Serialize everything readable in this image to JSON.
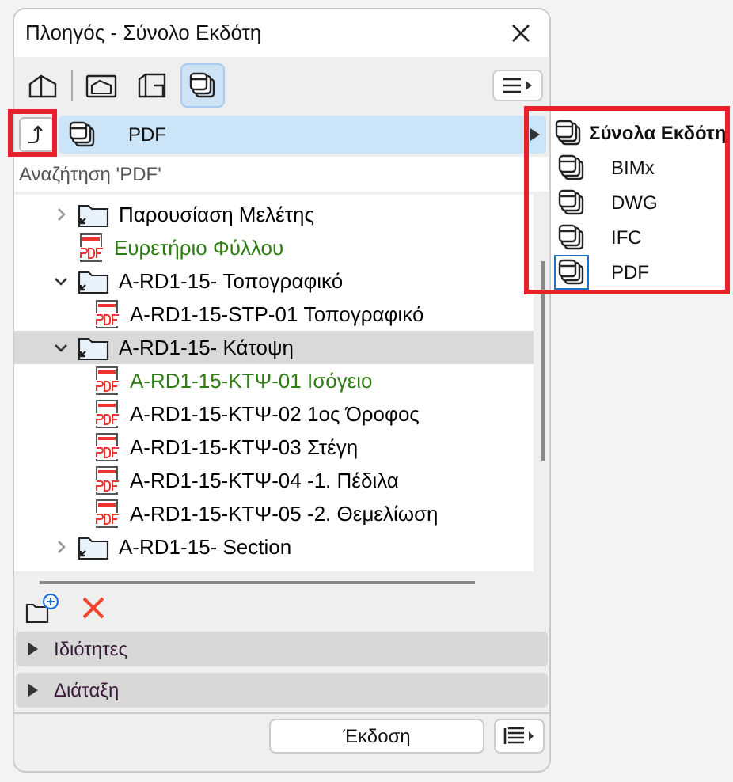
{
  "window": {
    "title": "Πλοηγός - Σύνολο Εκδότη"
  },
  "toolbar": {
    "buttons": [
      {
        "kind": "project",
        "selected": false
      },
      {
        "kind": "view",
        "selected": false
      },
      {
        "kind": "layout",
        "selected": false
      },
      {
        "kind": "publisher",
        "selected": true
      }
    ]
  },
  "current_set": {
    "label": "PDF"
  },
  "search": {
    "placeholder": "Αναζήτηση 'PDF'"
  },
  "tree": [
    {
      "kind": "folder",
      "label": "Παρουσίαση Μελέτης",
      "expanded": false,
      "selected": false,
      "color": "#000000"
    },
    {
      "kind": "pdf",
      "label": "Ευρετήριο Φύλλου",
      "selected": false,
      "color": "#2e7d14"
    },
    {
      "kind": "folder",
      "label": "A-RD1-15- Τοπογραφικό",
      "expanded": true,
      "selected": false,
      "color": "#000000",
      "children": [
        {
          "kind": "pdf",
          "label": "A-RD1-15-STP-01 Τοπογραφικό",
          "selected": false,
          "color": "#000000"
        }
      ]
    },
    {
      "kind": "folder",
      "label": "A-RD1-15- Κάτοψη",
      "expanded": true,
      "selected": true,
      "color": "#000000",
      "children": [
        {
          "kind": "pdf",
          "label": "A-RD1-15-ΚΤΨ-01 Ισόγειο",
          "selected": false,
          "color": "#2e7d14"
        },
        {
          "kind": "pdf",
          "label": "A-RD1-15-ΚΤΨ-02 1ος Όροφος",
          "selected": false,
          "color": "#000000"
        },
        {
          "kind": "pdf",
          "label": "A-RD1-15-ΚΤΨ-03 Στέγη",
          "selected": false,
          "color": "#000000"
        },
        {
          "kind": "pdf",
          "label": "A-RD1-15-ΚΤΨ-04 -1. Πέδιλα",
          "selected": false,
          "color": "#000000"
        },
        {
          "kind": "pdf",
          "label": "A-RD1-15-ΚΤΨ-05 -2. Θεμελίωση",
          "selected": false,
          "color": "#000000"
        }
      ]
    },
    {
      "kind": "folder",
      "label": "A-RD1-15- Section",
      "expanded": false,
      "selected": false,
      "color": "#000000"
    }
  ],
  "panels": [
    {
      "label": "Ιδιότητες",
      "expanded": false
    },
    {
      "label": "Διάταξη",
      "expanded": false
    }
  ],
  "publish_button": "Έκδοση",
  "popup_menu": {
    "title": "Σύνολα Εκδότη",
    "items": [
      {
        "label": "BIMx",
        "selected": false
      },
      {
        "label": "DWG",
        "selected": false
      },
      {
        "label": "IFC",
        "selected": false
      },
      {
        "label": "PDF",
        "selected": true
      }
    ]
  }
}
